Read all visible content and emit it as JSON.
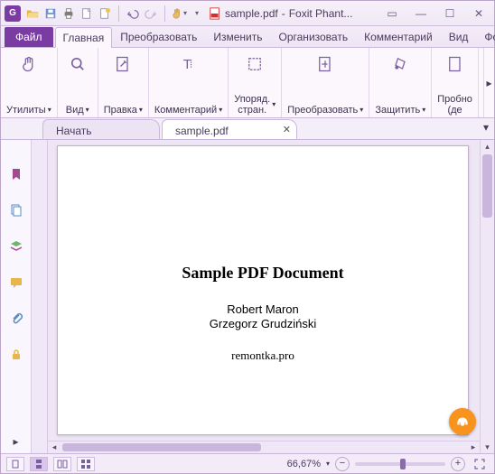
{
  "titlebar": {
    "app_glyph": "G",
    "doc_name": "sample.pdf",
    "app_name": "Foxit Phant..."
  },
  "ribbon_tabs": {
    "file": "Файл",
    "items": [
      "Главная",
      "Преобразовать",
      "Изменить",
      "Организовать",
      "Комментарий",
      "Вид",
      "Форма"
    ],
    "active_index": 0
  },
  "ribbon_groups": [
    {
      "label": "Утилиты",
      "dd": true
    },
    {
      "label": "Вид",
      "dd": true
    },
    {
      "label": "Правка",
      "dd": true
    },
    {
      "label": "Комментарий",
      "dd": true
    },
    {
      "label": "Упоряд. стран.",
      "dd": true
    },
    {
      "label": "Преобразовать",
      "dd": true
    },
    {
      "label": "Защитить",
      "dd": true
    },
    {
      "label": "Пробно (де",
      "dd": false
    }
  ],
  "doc_tabs": [
    {
      "label": "Начать",
      "closable": false,
      "active": false
    },
    {
      "label": "sample.pdf",
      "closable": true,
      "active": true
    }
  ],
  "document": {
    "title": "Sample PDF Document",
    "author1": "Robert Maron",
    "author2": "Grzegorz Grudziński",
    "site": "remontka.pro"
  },
  "status": {
    "zoom_label": "66,67%"
  }
}
